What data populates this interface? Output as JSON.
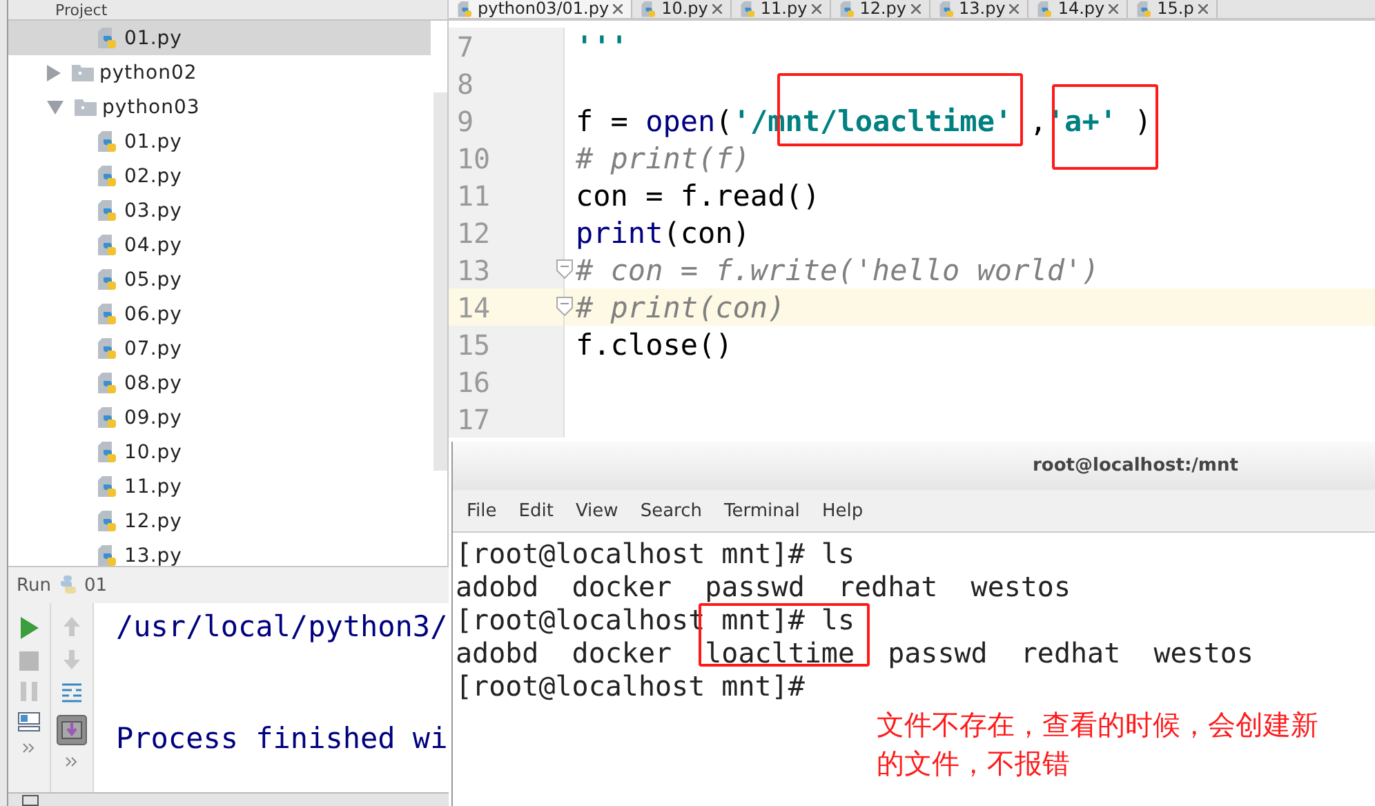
{
  "project_panel": {
    "title": "Project",
    "tree": [
      {
        "label": "01.py",
        "kind": "file",
        "selected": true
      },
      {
        "label": "python02",
        "kind": "folder",
        "expanded": false,
        "selected": false
      },
      {
        "label": "python03",
        "kind": "folder",
        "expanded": true,
        "selected": false,
        "children": [
          {
            "label": "01.py",
            "kind": "file",
            "selected": false
          },
          {
            "label": "02.py",
            "kind": "file",
            "selected": false
          },
          {
            "label": "03.py",
            "kind": "file",
            "selected": false
          },
          {
            "label": "04.py",
            "kind": "file",
            "selected": false
          },
          {
            "label": "05.py",
            "kind": "file",
            "selected": false
          },
          {
            "label": "06.py",
            "kind": "file",
            "selected": false
          },
          {
            "label": "07.py",
            "kind": "file",
            "selected": false
          },
          {
            "label": "08.py",
            "kind": "file",
            "selected": false
          },
          {
            "label": "09.py",
            "kind": "file",
            "selected": false
          },
          {
            "label": "10.py",
            "kind": "file",
            "selected": false
          },
          {
            "label": "11.py",
            "kind": "file",
            "selected": false
          },
          {
            "label": "12.py",
            "kind": "file",
            "selected": false
          },
          {
            "label": "13.py",
            "kind": "file",
            "selected": false
          }
        ]
      }
    ]
  },
  "editor": {
    "tabs": [
      {
        "label": "python03/01.py",
        "selected": true
      },
      {
        "label": "10.py",
        "selected": false
      },
      {
        "label": "11.py",
        "selected": false
      },
      {
        "label": "12.py",
        "selected": false
      },
      {
        "label": "13.py",
        "selected": false
      },
      {
        "label": "14.py",
        "selected": false
      },
      {
        "label": "15.p",
        "selected": false
      }
    ],
    "lines": [
      {
        "number": "7",
        "current": false,
        "fold": false,
        "tokens": [
          {
            "kind": "string",
            "text": "'''"
          }
        ]
      },
      {
        "number": "8",
        "current": false,
        "fold": false
      },
      {
        "number": "9",
        "current": false,
        "fold": false,
        "tokens": [
          {
            "kind": "plain",
            "text": "f = "
          },
          {
            "kind": "builtin",
            "text": "open"
          },
          {
            "kind": "plain",
            "text": "("
          },
          {
            "kind": "string",
            "text": "'/mnt/loacltime'"
          },
          {
            "kind": "plain",
            "text": " ,"
          },
          {
            "kind": "string",
            "text": "'a+'"
          },
          {
            "kind": "plain",
            "text": " )"
          }
        ]
      },
      {
        "number": "10",
        "current": false,
        "fold": false,
        "tokens": [
          {
            "kind": "comment",
            "text": "# print(f)"
          }
        ]
      },
      {
        "number": "11",
        "current": false,
        "fold": false,
        "tokens": [
          {
            "kind": "plain",
            "text": "con = f.read()"
          }
        ]
      },
      {
        "number": "12",
        "current": false,
        "fold": false,
        "tokens": [
          {
            "kind": "builtin",
            "text": "print"
          },
          {
            "kind": "plain",
            "text": "(con)"
          }
        ]
      },
      {
        "number": "13",
        "current": false,
        "fold": true,
        "tokens": [
          {
            "kind": "comment",
            "text": "# con = f.write('hello world')"
          }
        ]
      },
      {
        "number": "14",
        "current": true,
        "fold": true,
        "tokens": [
          {
            "kind": "comment",
            "text": "# print(con)"
          }
        ]
      },
      {
        "number": "15",
        "current": false,
        "fold": false,
        "tokens": [
          {
            "kind": "plain",
            "text": "f.close()"
          }
        ]
      },
      {
        "number": "16",
        "current": false,
        "fold": false
      },
      {
        "number": "17",
        "current": false,
        "fold": false
      }
    ]
  },
  "run_panel": {
    "title": "Run",
    "config": "01",
    "output": [
      {
        "kind": "command",
        "text": "/usr/local/python3/"
      },
      {
        "kind": "exit",
        "text": "Process finished wi"
      }
    ]
  },
  "terminal": {
    "title": "root@localhost:/mnt",
    "menu": [
      "File",
      "Edit",
      "View",
      "Search",
      "Terminal",
      "Help"
    ],
    "lines": [
      "[root@localhost mnt]# ls",
      "adobd  docker  passwd  redhat  westos",
      "[root@localhost mnt]# ls",
      "adobd  docker  loacltime  passwd  redhat  westos",
      "[root@localhost mnt]#"
    ]
  },
  "annotation": {
    "note": "文件不存在，查看的时候，会创建新的文件，不报错"
  }
}
